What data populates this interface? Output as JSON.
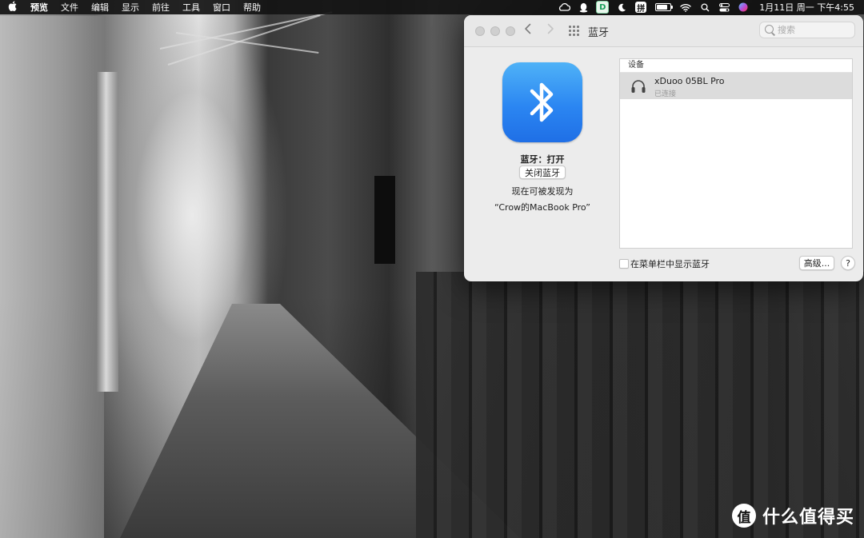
{
  "menubar": {
    "app_name": "预览",
    "items": [
      "文件",
      "编辑",
      "显示",
      "前往",
      "工具",
      "窗口",
      "帮助"
    ],
    "status_icons": [
      "creative-cloud-icon",
      "qq-icon",
      "app-icon",
      "moon-icon",
      "input-method-icon",
      "battery-icon",
      "wifi-icon",
      "search-icon",
      "control-center-icon",
      "siri-icon"
    ],
    "input_method_label": "拼",
    "clock": "1月11日 周一 下午4:55"
  },
  "window": {
    "title": "蓝牙",
    "search_placeholder": "搜索",
    "bluetooth_status": "蓝牙：打开",
    "toggle_button": "关闭蓝牙",
    "discoverable_text": "现在可被发现为",
    "computer_name": "“Crow的MacBook Pro”",
    "devices_header": "设备",
    "devices": [
      {
        "name": "xDuoo 05BL Pro",
        "status": "已连接",
        "icon": "headphones-icon"
      }
    ],
    "show_in_menubar_label": "在菜单栏中显示蓝牙",
    "show_in_menubar_checked": false,
    "advanced_button": "高级...",
    "help_button": "?"
  },
  "watermark": {
    "badge": "值",
    "text": "什么值得买"
  },
  "colors": {
    "accent_blue": "#2b86f2",
    "menubar_bg": "#141414",
    "window_bg": "#ececec",
    "selected_row": "#dcdcdc"
  }
}
